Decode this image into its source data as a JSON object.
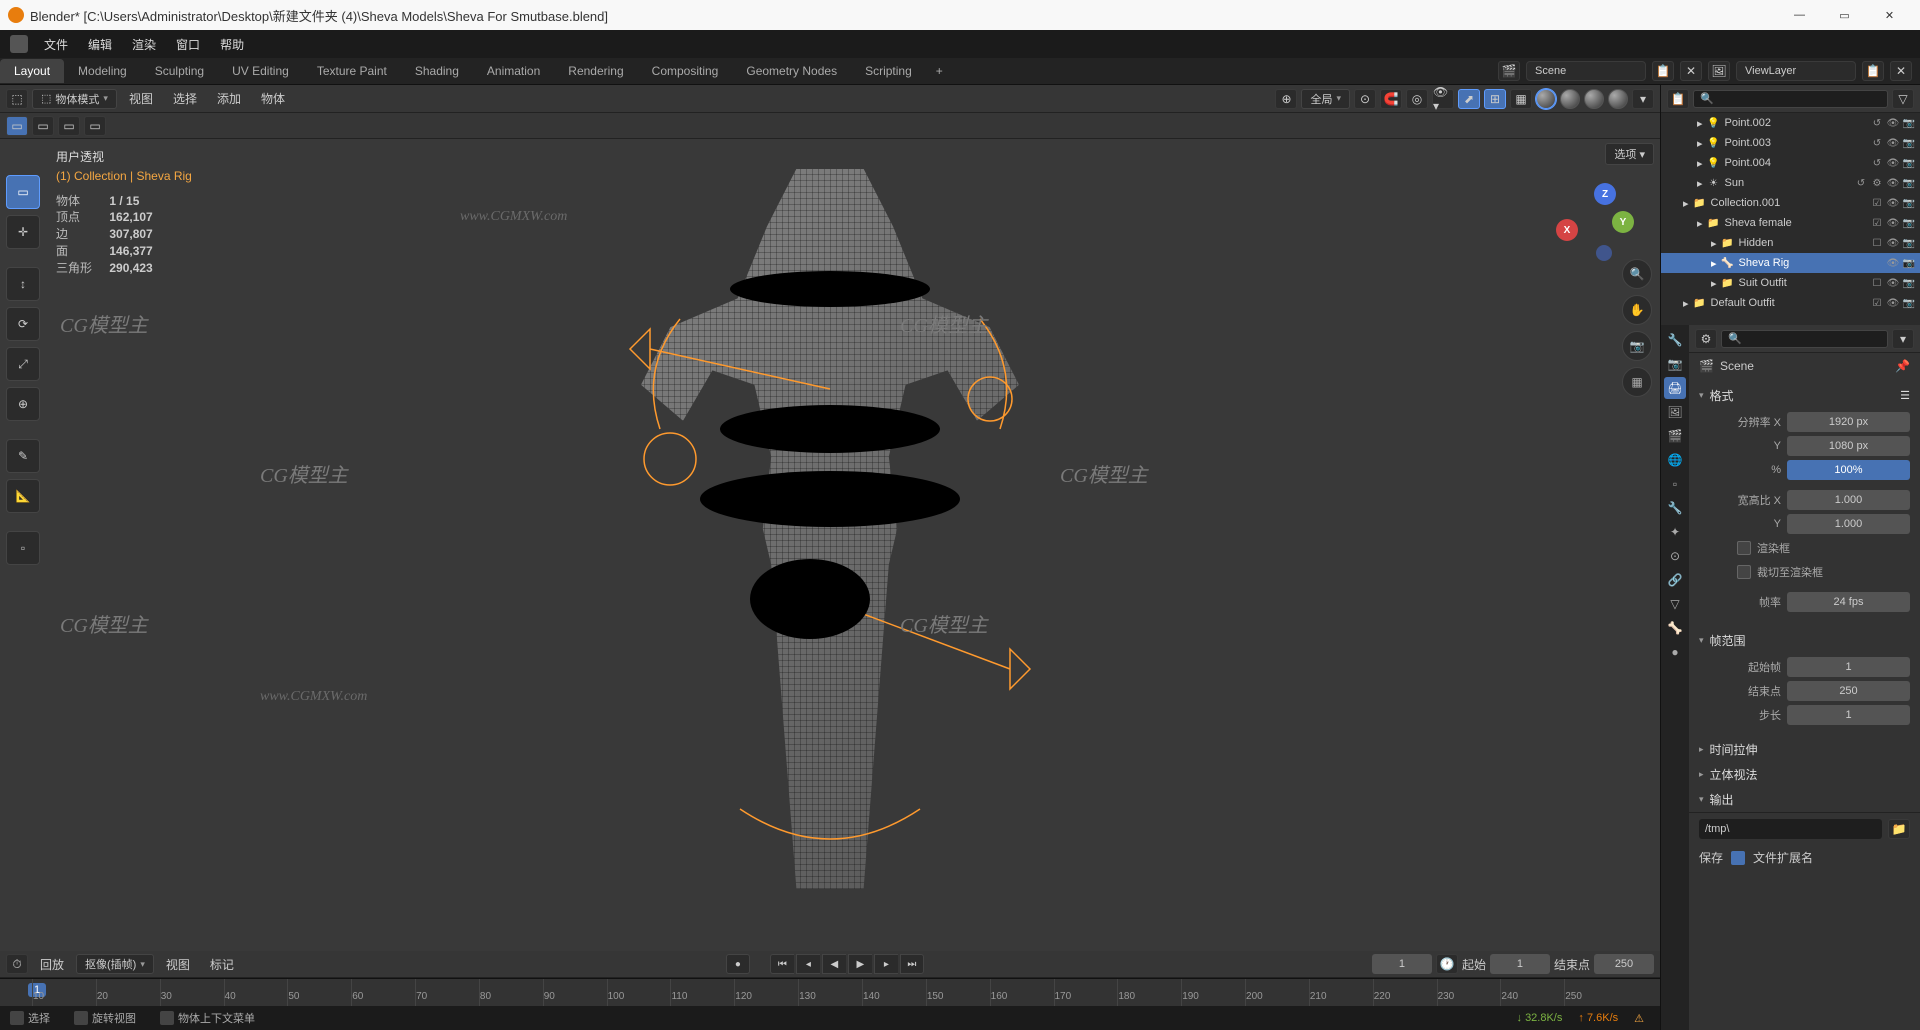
{
  "window": {
    "title": "Blender* [C:\\Users\\Administrator\\Desktop\\新建文件夹 (4)\\Sheva Models\\Sheva For Smutbase.blend]"
  },
  "top_menu": [
    "文件",
    "编辑",
    "渲染",
    "窗口",
    "帮助"
  ],
  "workspaces": [
    "Layout",
    "Modeling",
    "Sculpting",
    "UV Editing",
    "Texture Paint",
    "Shading",
    "Animation",
    "Rendering",
    "Compositing",
    "Geometry Nodes",
    "Scripting"
  ],
  "active_workspace": "Layout",
  "scene_field": "Scene",
  "viewlayer_field": "ViewLayer",
  "viewport_header": {
    "mode": "物体模式",
    "menus": [
      "视图",
      "选择",
      "添加",
      "物体"
    ],
    "orientation": "全局"
  },
  "options_label": "选项",
  "overlay": {
    "title": "用户透视",
    "path": "(1) Collection | Sheva Rig",
    "stats": {
      "objects_label": "物体",
      "objects": "1 / 15",
      "verts_label": "顶点",
      "verts": "162,107",
      "edges_label": "边",
      "edges": "307,807",
      "faces_label": "面",
      "faces": "146,377",
      "tris_label": "三角形",
      "tris": "290,423"
    }
  },
  "gizmo": {
    "x": "X",
    "y": "Y",
    "z": "Z"
  },
  "outliner": {
    "search_placeholder": "",
    "items": [
      {
        "indent": 28,
        "icon": "💡",
        "name": "Point.002",
        "toggles": [
          "↺",
          "👁",
          "📷"
        ]
      },
      {
        "indent": 28,
        "icon": "💡",
        "name": "Point.003",
        "toggles": [
          "↺",
          "👁",
          "📷"
        ]
      },
      {
        "indent": 28,
        "icon": "💡",
        "name": "Point.004",
        "toggles": [
          "↺",
          "👁",
          "📷"
        ]
      },
      {
        "indent": 28,
        "icon": "☀",
        "name": "Sun",
        "toggles": [
          "↺",
          "⚙",
          "👁",
          "📷"
        ]
      },
      {
        "indent": 14,
        "icon": "📁",
        "name": "Collection.001",
        "toggles": [
          "☑",
          "👁",
          "📷"
        ]
      },
      {
        "indent": 28,
        "icon": "📁",
        "name": "Sheva female",
        "toggles": [
          "☑",
          "👁",
          "📷"
        ]
      },
      {
        "indent": 42,
        "icon": "📁",
        "name": "Hidden",
        "toggles": [
          "☐",
          "👁",
          "📷"
        ]
      },
      {
        "indent": 42,
        "icon": "🦴",
        "name": "Sheva Rig",
        "toggles": [
          "👁",
          "📷"
        ],
        "selected": true
      },
      {
        "indent": 42,
        "icon": "📁",
        "name": "Suit Outfit",
        "toggles": [
          "☐",
          "👁",
          "📷"
        ]
      },
      {
        "indent": 14,
        "icon": "📁",
        "name": "Default Outfit",
        "toggles": [
          "☑",
          "👁",
          "📷"
        ]
      }
    ]
  },
  "properties": {
    "context": "Scene",
    "panels": {
      "format": {
        "title": "格式",
        "res_x_label": "分辨率 X",
        "res_x": "1920 px",
        "res_y_label": "Y",
        "res_y": "1080 px",
        "pct_label": "%",
        "pct": "100%",
        "aspect_x_label": "宽高比 X",
        "aspect_x": "1.000",
        "aspect_y_label": "Y",
        "aspect_y": "1.000",
        "chk1": "渲染框",
        "chk2": "裁切至渲染框",
        "fps_label": "帧率",
        "fps": "24 fps"
      },
      "frame_range": {
        "title": "帧范围",
        "start_label": "起始帧",
        "start": "1",
        "end_label": "结束点",
        "end": "250",
        "step_label": "步长",
        "step": "1"
      },
      "time_stretch": "时间拉伸",
      "stereo": "立体视法",
      "output": {
        "title": "输出",
        "path": "/tmp\\"
      },
      "save_label": "保存",
      "ext_label": "文件扩展名"
    }
  },
  "timeline": {
    "playback": "回放",
    "keying": "抠像(插帧)",
    "view": "视图",
    "marker": "标记",
    "current": "1",
    "start_label": "起始",
    "start": "1",
    "end_label": "结束点",
    "end": "250",
    "cur_frame": "1",
    "ticks": [
      "10",
      "20",
      "30",
      "40",
      "50",
      "60",
      "70",
      "80",
      "90",
      "100",
      "110",
      "120",
      "130",
      "140",
      "150",
      "160",
      "170",
      "180",
      "190",
      "200",
      "210",
      "220",
      "230",
      "240",
      "250"
    ]
  },
  "status": {
    "select": "选择",
    "rotate": "旋转视图",
    "context": "物体上下文菜单",
    "down": "32.8K/s",
    "up": "7.6K/s"
  }
}
